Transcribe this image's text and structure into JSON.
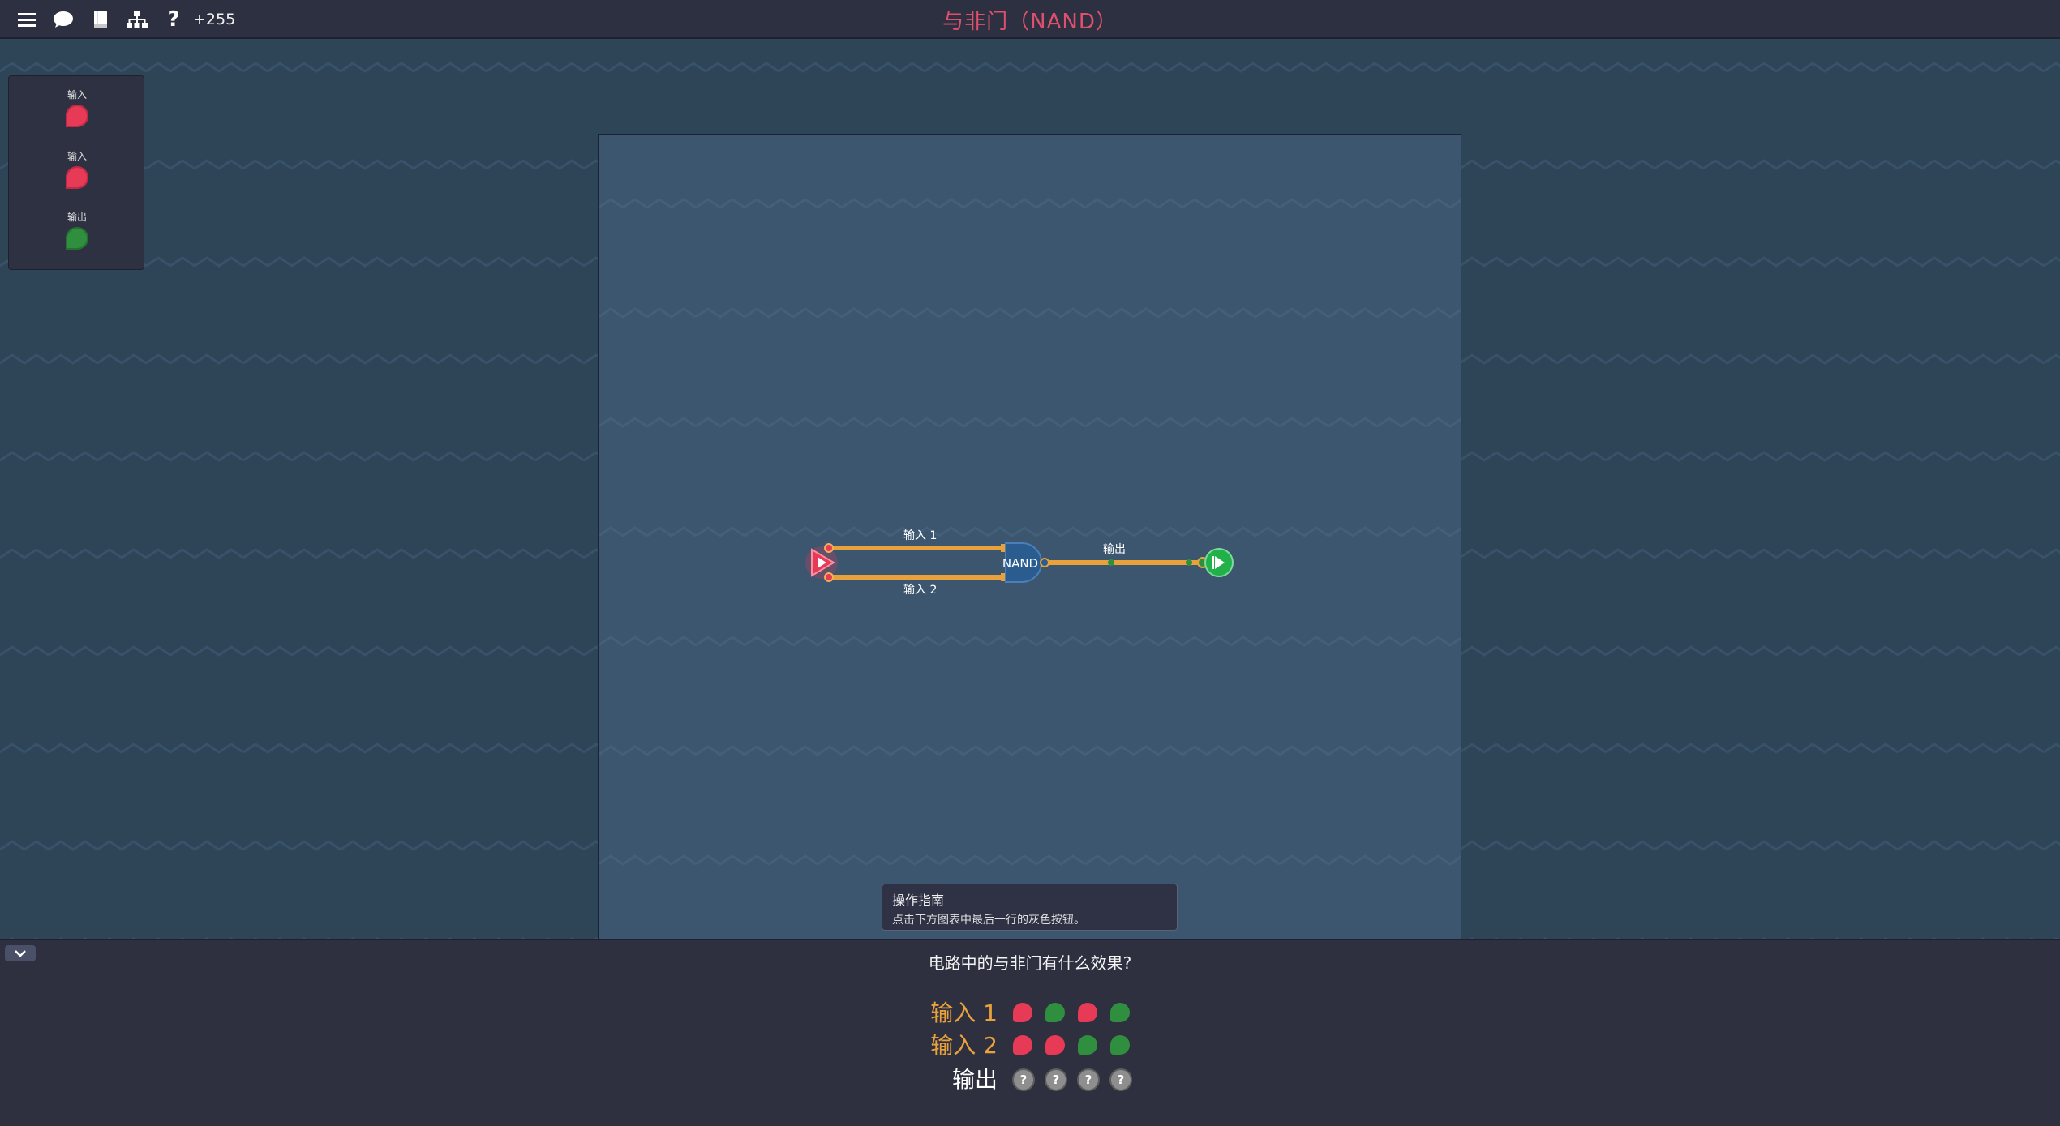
{
  "topbar": {
    "icons": [
      "menu-icon",
      "chat-icon",
      "book-icon",
      "hierarchy-icon",
      "help-icon"
    ],
    "help_glyph": "?",
    "score": "+255",
    "title": "与非门（NAND）"
  },
  "palette": {
    "items": [
      {
        "label": "输入",
        "state": "red"
      },
      {
        "label": "输入",
        "state": "red"
      },
      {
        "label": "输出",
        "state": "green"
      }
    ]
  },
  "circuit": {
    "gate_label": "NAND",
    "wire_labels": {
      "input1": "输入 1",
      "input2": "输入 2",
      "output": "输出"
    }
  },
  "guide": {
    "title": "操作指南",
    "text": "点击下方图表中最后一行的灰色按钮。"
  },
  "truth_table": {
    "question": "电路中的与非门有什么效果?",
    "rows": [
      {
        "label": "输入 1",
        "cells": [
          "red",
          "green",
          "red",
          "green"
        ]
      },
      {
        "label": "输入 2",
        "cells": [
          "red",
          "red",
          "green",
          "green"
        ]
      },
      {
        "label": "输出",
        "cells": [
          "?",
          "?",
          "?",
          "?"
        ]
      }
    ]
  },
  "colors": {
    "red": "#e63a57",
    "green": "#2f8f3e",
    "wire": "#e9a23b",
    "title": "#e0506e"
  }
}
